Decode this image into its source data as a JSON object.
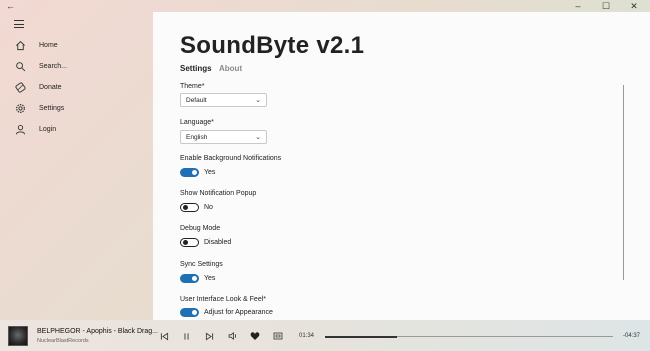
{
  "window": {
    "back": "←",
    "minimize": "–",
    "maximize": "☐",
    "close": "✕"
  },
  "sidebar": {
    "items": [
      {
        "label": "Home",
        "icon": "home-icon"
      },
      {
        "label": "Search...",
        "icon": "search-icon"
      },
      {
        "label": "Donate",
        "icon": "donate-icon"
      },
      {
        "label": "Settings",
        "icon": "gear-icon"
      },
      {
        "label": "Login",
        "icon": "user-icon"
      }
    ]
  },
  "main": {
    "title": "SoundByte v2.1",
    "tabs": [
      {
        "label": "Settings",
        "active": true
      },
      {
        "label": "About",
        "active": false
      }
    ],
    "theme": {
      "label": "Theme*",
      "value": "Default"
    },
    "language": {
      "label": "Language*",
      "value": "English"
    },
    "bg_notifications": {
      "label": "Enable Background Notifications",
      "state": "Yes",
      "on": true
    },
    "popup": {
      "label": "Show Notification Popup",
      "state": "No",
      "on": false
    },
    "debug": {
      "label": "Debug Mode",
      "state": "Disabled",
      "on": false
    },
    "sync": {
      "label": "Sync Settings",
      "state": "Yes",
      "on": true
    },
    "look": {
      "label": "User Interface Look & Feel*",
      "state": "Adjust for Appearance",
      "on": true
    }
  },
  "player": {
    "track_title": "BELPHEGOR - Apophis - Black Drag...",
    "artist": "NuclearBlastRecords",
    "elapsed": "01:34",
    "remaining": "-04:37",
    "progress": 0.25
  },
  "colors": {
    "accent": "#1f6fb5"
  }
}
